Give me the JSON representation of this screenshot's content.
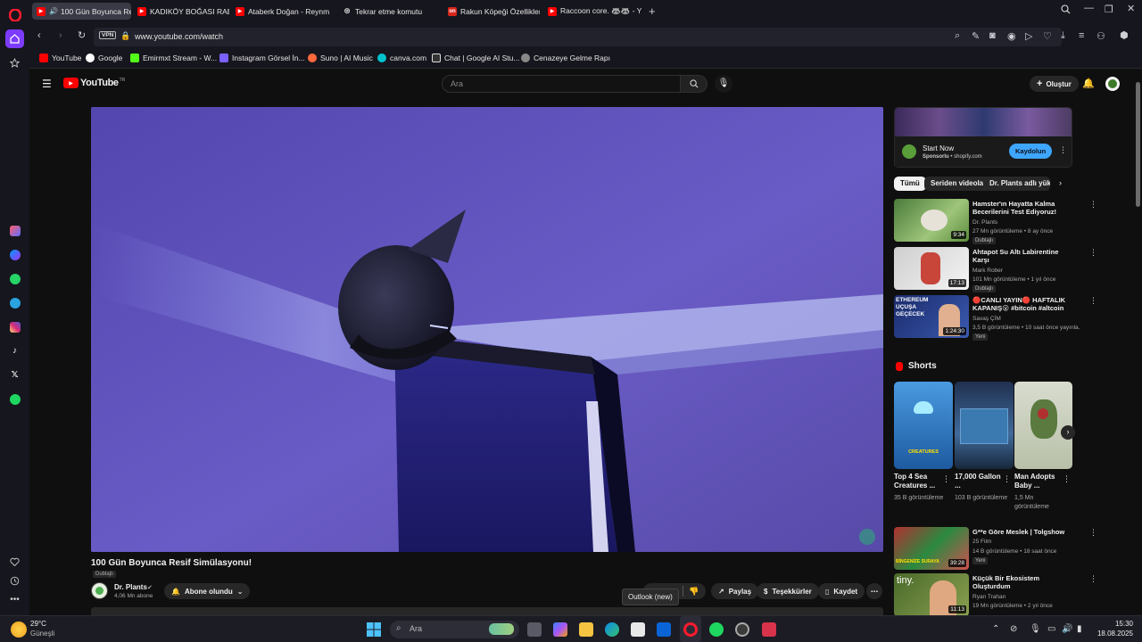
{
  "browser": {
    "tabs": [
      {
        "label": "100 Gün Boyunca Res",
        "active": true
      },
      {
        "label": "KADIKÖY BOĞASI RABİA C"
      },
      {
        "label": "Ataberk Doğan - Reynme"
      },
      {
        "label": "Tekrar etme komutu"
      },
      {
        "label": "Rakun Köpeği Özellikleri N"
      },
      {
        "label": "Raccoon core. 🦝🦝 - Yo"
      }
    ],
    "url": "www.youtube.com/watch",
    "vpn_label": "VPN",
    "bookmarks": [
      {
        "label": "YouTube",
        "color": "#ff0000"
      },
      {
        "label": "Google",
        "color": "#ffffff"
      },
      {
        "label": "Emirmxt Stream - W...",
        "color": "#53fc18"
      },
      {
        "label": "Instagram Görsel İn...",
        "color": "#7b61ff"
      },
      {
        "label": "Suno | AI Music",
        "color": "#ff6a3d"
      },
      {
        "label": "canva.com",
        "color": "#00c4cc"
      },
      {
        "label": "Chat | Google AI Stu...",
        "color": "#dddddd"
      },
      {
        "label": "Cenazeye Gelme Rapı",
        "color": "#aaaaaa"
      }
    ]
  },
  "youtube": {
    "logo": "YouTube",
    "logo_region": "TR",
    "search_placeholder": "Ara",
    "create_label": "Oluştur",
    "video": {
      "title": "100 Gün Boyunca Resif Simülasyonu!",
      "dubbed": "Dublajlı",
      "channel": "Dr. Plants",
      "subscribers": "4,06 Mn abone",
      "subscribed_label": "Abone olundu",
      "share": "Paylaş",
      "thanks": "Teşekkürler",
      "save": "Kaydet"
    },
    "ad": {
      "title": "Start Now",
      "sponsored": "Sponsorlu",
      "domain": "shopify.com",
      "cta": "Kaydolun"
    },
    "chips": [
      "Tümü",
      "Seriden videolar",
      "Dr. Plants adlı yükleyic"
    ],
    "recommended": [
      {
        "title": "Hamster'ın Hayatta Kalma Becerilerini Test Ediyoruz!",
        "channel": "Dr. Plants",
        "meta": "27 Mn görüntüleme • 8 ay önce",
        "badge": "Dublajlı",
        "duration": "9:34"
      },
      {
        "title": "Ahtapot Su Altı Labirentine Karşı",
        "channel": "Mark Rober",
        "meta": "101 Mn görüntüleme • 1 yıl önce",
        "badge": "Dublajlı",
        "duration": "17:13"
      },
      {
        "title": "🔴CANLI YAYIN🔴 HAFTALIK KAPANIŞ😮 #bitcoin #altcoin",
        "channel": "Savaş ÇİM",
        "meta": "3,5 B görüntüleme • 10 saat önce yayınla...",
        "badge": "Yeni",
        "duration": "1:24:30",
        "thumb_text": "ETHEREUM UÇUŞA GEÇECEK"
      }
    ],
    "shorts_label": "Shorts",
    "shorts": [
      {
        "title": "Top 4 Sea Creatures ...",
        "views": "35 B görüntüleme",
        "thumb_text": "CREATURES"
      },
      {
        "title": "17,000 Gallon ...",
        "views": "103 B görüntüleme"
      },
      {
        "title": "Man Adopts Baby ...",
        "views": "1,5 Mn görüntüleme"
      }
    ],
    "recommended2": [
      {
        "title": "G**e Göre Meslek | Tolgshow",
        "channel": "25 Film",
        "meta": "14 B görüntüleme • 18 saat önce",
        "badge": "Yeni",
        "duration": "39:28",
        "thumb_text": "BİNGENİZE SURAYA"
      },
      {
        "title": "Küçük Bir Ekosistem Oluşturdum",
        "channel": "Ryan Trahan",
        "meta": "19 Mn görüntüleme • 2 yıl önce",
        "duration": "11:13",
        "thumb_text": "tiny."
      }
    ]
  },
  "taskbar": {
    "weather_temp": "29°C",
    "weather_desc": "Güneşli",
    "search_placeholder": "Ara",
    "tooltip": "Outlook (new)",
    "time": "15:30",
    "date": "18.08.2025"
  }
}
